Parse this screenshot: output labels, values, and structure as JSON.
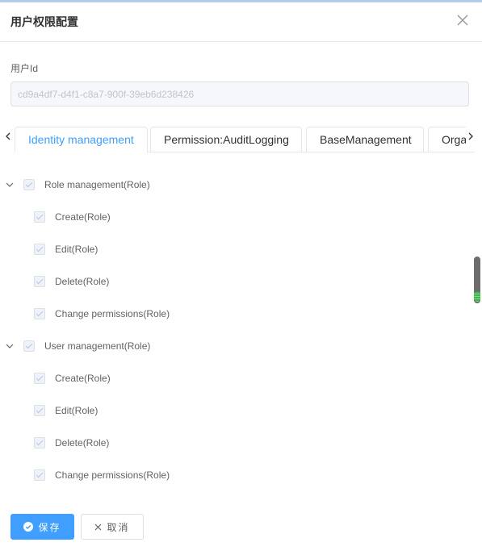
{
  "dialog": {
    "title": "用户权限配置"
  },
  "user_id_field": {
    "label": "用户Id",
    "value": "cd9a4df7-d4f1-c8a7-900f-39eb6d238426"
  },
  "tabs": [
    {
      "label": "Identity management",
      "active": true
    },
    {
      "label": "Permission:AuditLogging",
      "active": false
    },
    {
      "label": "BaseManagement",
      "active": false
    },
    {
      "label": "Orga",
      "active": false
    }
  ],
  "tree": {
    "groups": [
      {
        "label": "Role management(Role)",
        "checked": true,
        "expanded": true,
        "children": [
          {
            "label": "Create(Role)",
            "checked": true
          },
          {
            "label": "Edit(Role)",
            "checked": true
          },
          {
            "label": "Delete(Role)",
            "checked": true
          },
          {
            "label": "Change permissions(Role)",
            "checked": true
          }
        ]
      },
      {
        "label": "User management(Role)",
        "checked": true,
        "expanded": true,
        "children": [
          {
            "label": "Create(Role)",
            "checked": true
          },
          {
            "label": "Edit(Role)",
            "checked": true
          },
          {
            "label": "Delete(Role)",
            "checked": true
          },
          {
            "label": "Change permissions(Role)",
            "checked": true
          }
        ]
      }
    ]
  },
  "footer": {
    "save_label": "保存",
    "cancel_label": "取消"
  },
  "icons": {
    "close": "close-icon",
    "tab_prev": "chevron-left-icon",
    "tab_next": "chevron-right-icon",
    "expand": "chevron-down-icon",
    "save": "check-circle-icon",
    "cancel": "close-icon"
  },
  "colors": {
    "primary": "#409eff",
    "text": "#606266",
    "title": "#303133",
    "disabled_bg": "#f5f7fa",
    "scroll_accent": "#43b649"
  }
}
